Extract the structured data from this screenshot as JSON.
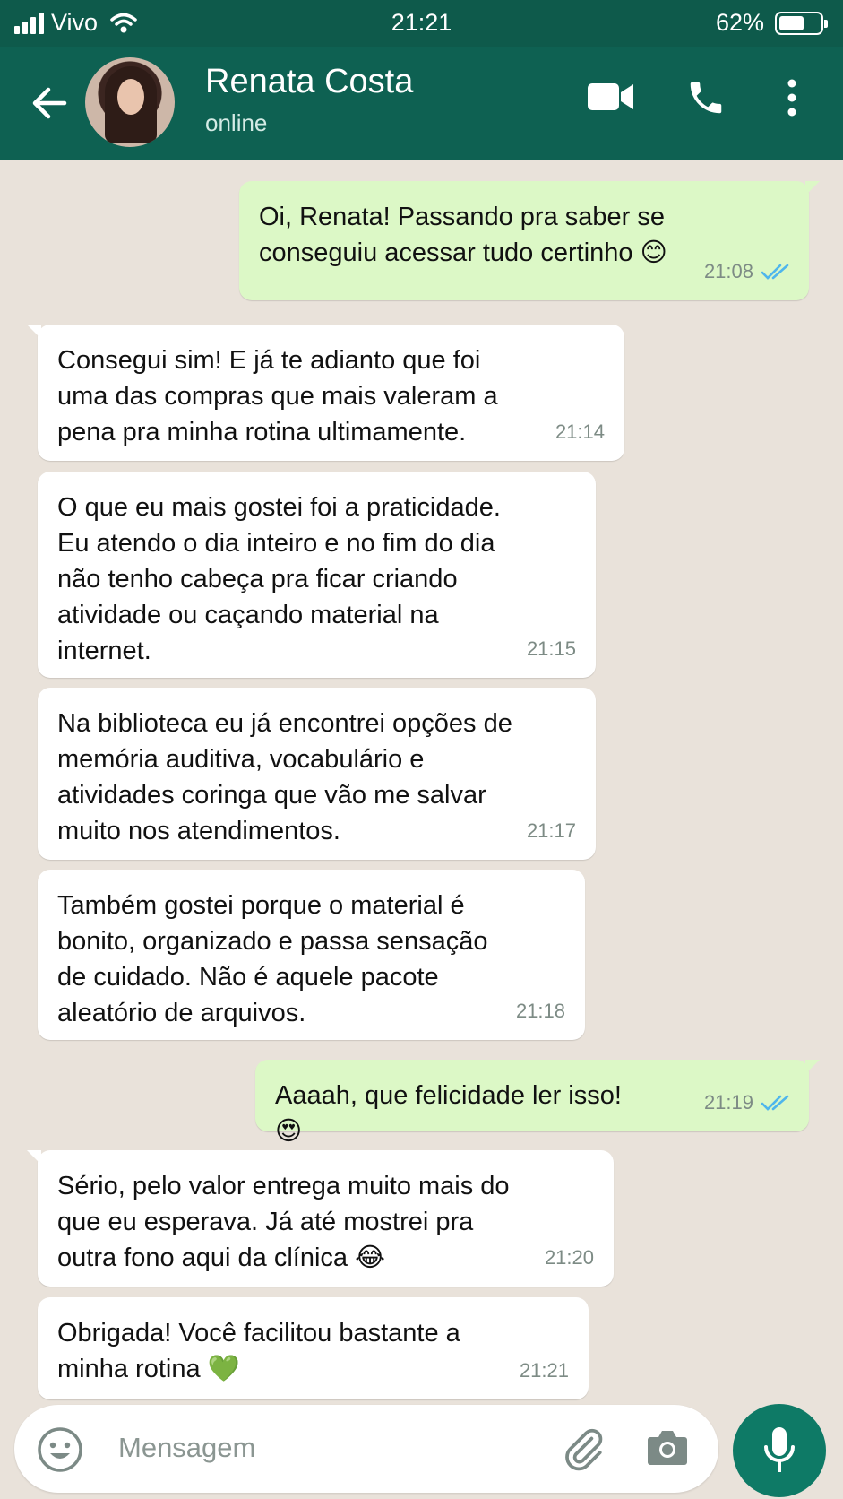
{
  "status_bar": {
    "carrier": "Vivo",
    "time": "21:21",
    "battery": "62%",
    "battery_level": 0.62
  },
  "header": {
    "contact_name": "Renata Costa",
    "contact_status": "online",
    "icons": [
      "back-arrow-icon",
      "video-call-icon",
      "phone-icon",
      "more-options-icon"
    ]
  },
  "messages": [
    {
      "direction": "out",
      "text": "Oi, Renata! Passando pra saber se\nconseguiu acessar tudo certinho 😊",
      "time": "21:08",
      "read": true
    },
    {
      "direction": "in",
      "text": "Consegui sim! E já te adianto que foi\numa das compras que mais valeram a\npena pra minha rotina ultimamente.",
      "time": "21:14"
    },
    {
      "direction": "in",
      "text": "O que eu mais gostei foi a praticidade.\nEu atendo o dia inteiro e no fim do dia\nnão tenho cabeça pra ficar criando\natividade ou caçando material na\ninternet.",
      "time": "21:15"
    },
    {
      "direction": "in",
      "text": "Na biblioteca eu já encontrei opções de\nmemória auditiva, vocabulário e\natividades coringa que vão me salvar\nmuito nos atendimentos.",
      "time": "21:17"
    },
    {
      "direction": "in",
      "text": "Também gostei porque o material é\nbonito, organizado e passa sensação\nde cuidado. Não é aquele pacote\naleatório de arquivos.",
      "time": "21:18"
    },
    {
      "direction": "out",
      "text": "Aaaah, que felicidade ler isso! 😍",
      "time": "21:19",
      "read": true
    },
    {
      "direction": "in",
      "text": "Sério, pelo valor entrega muito mais do\nque eu esperava. Já até mostrei pra\noutra fono aqui da clínica 😂",
      "time": "21:20"
    },
    {
      "direction": "in",
      "text": "Obrigada! Você facilitou bastante a\nminha rotina 💚",
      "time": "21:21"
    }
  ],
  "composer": {
    "placeholder": "Mensagem",
    "icons": [
      "emoji-icon",
      "attach-icon",
      "camera-icon",
      "mic-icon"
    ]
  },
  "colors": {
    "header": "#0e6152",
    "status_bar": "#0e5a4b",
    "outgoing_bubble": "#dcf8c6",
    "incoming_bubble": "#ffffff",
    "read_ticks": "#4fb6ec",
    "chat_background": "#e9e2da",
    "mic_button": "#0e7a66"
  }
}
